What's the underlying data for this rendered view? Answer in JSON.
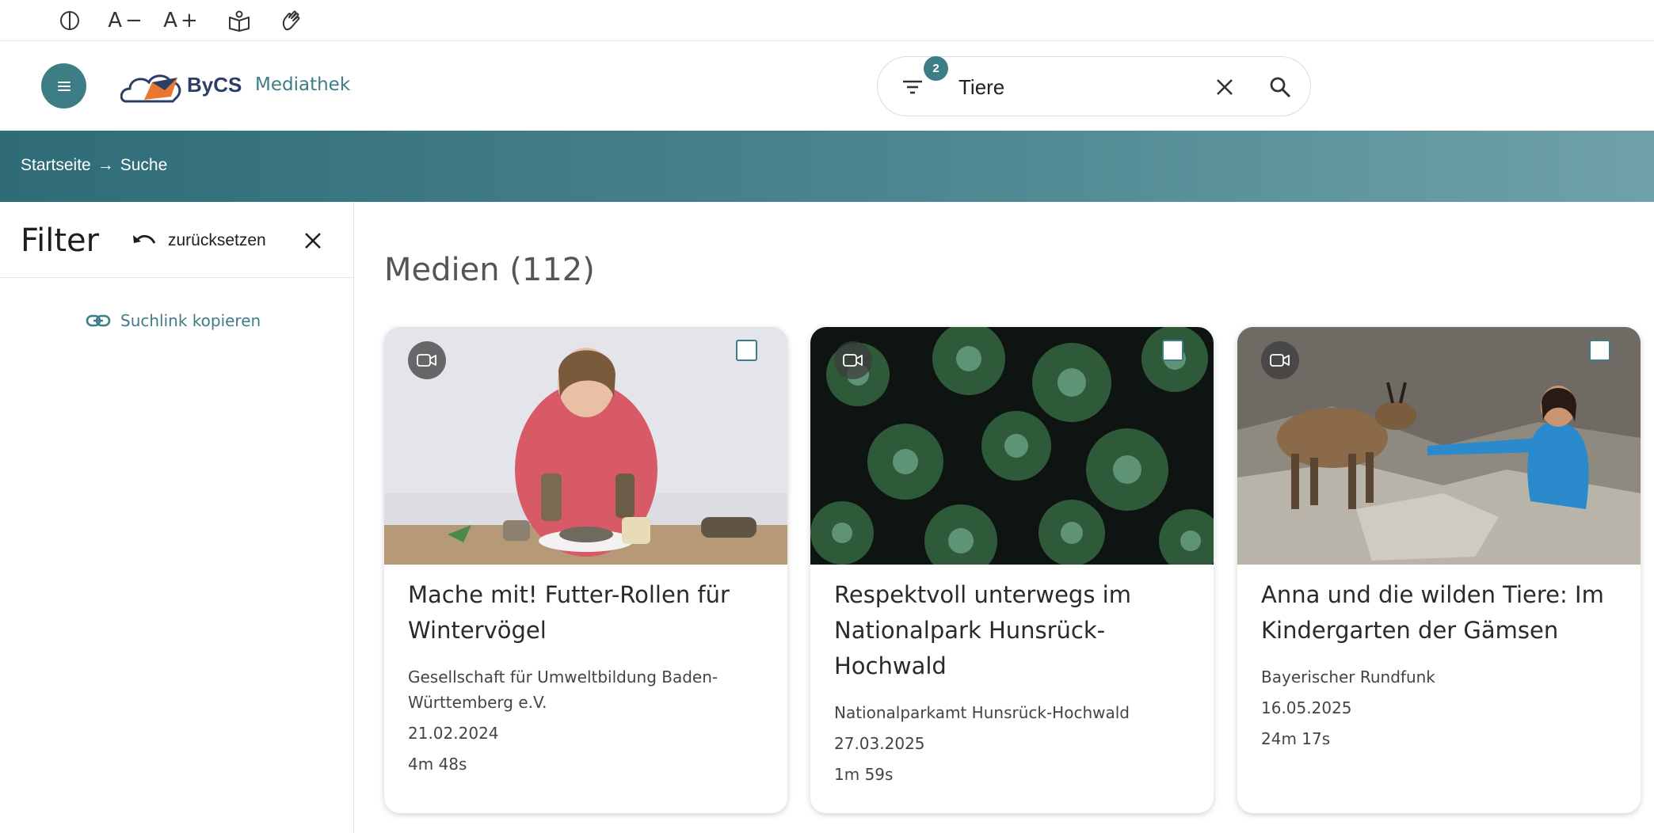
{
  "toolbar": {
    "icons": [
      "contrast-icon",
      "font-decrease-icon",
      "font-increase-icon",
      "reading-icon",
      "sign-language-icon"
    ],
    "font_decrease_glyph": "A−",
    "font_increase_glyph": "A+"
  },
  "header": {
    "logo_text": "ByCS",
    "app_name": "Mediathek"
  },
  "search": {
    "filter_count": "2",
    "query": "Tiere"
  },
  "breadcrumb": {
    "home": "Startseite",
    "arrow": "→",
    "current": "Suche"
  },
  "filter_panel": {
    "title": "Filter",
    "reset_label": "zurücksetzen",
    "copy_link_label": "Suchlink kopieren"
  },
  "results": {
    "title": "Medien (112)",
    "cards": [
      {
        "title": "Mache mit! Futter-Rollen für Wintervögel",
        "publisher": "Gesellschaft für Umweltbildung Baden-Württemberg e.V.",
        "date": "21.02.2024",
        "duration": "4m 48s",
        "media_type": "video-icon"
      },
      {
        "title": "Respektvoll unterwegs im Nationalpark Hunsrück-Hochwald",
        "publisher": "Nationalparkamt Hunsrück-Hochwald",
        "date": "27.03.2025",
        "duration": "1m 59s",
        "media_type": "video-icon"
      },
      {
        "title": "Anna und die wilden Tiere: Im Kindergarten der Gämsen",
        "publisher": "Bayerischer Rundfunk",
        "date": "16.05.2025",
        "duration": "24m 17s",
        "media_type": "video-icon"
      }
    ]
  },
  "colors": {
    "accent": "#3d7d86",
    "banner_start": "#2f6c77",
    "banner_end": "#6fa2a8",
    "brand_navy": "#2c3e66",
    "brand_orange": "#e8782e"
  }
}
